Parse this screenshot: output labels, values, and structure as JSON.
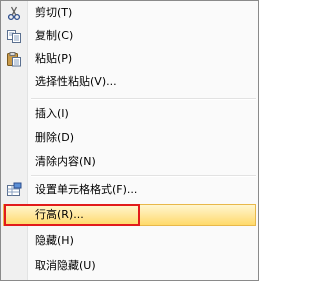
{
  "menu": {
    "items": [
      {
        "label": "剪切(T)",
        "icon": "scissors-icon"
      },
      {
        "label": "复制(C)",
        "icon": "copy-icon"
      },
      {
        "label": "粘贴(P)",
        "icon": "paste-icon"
      },
      {
        "label": "选择性粘贴(V)..."
      },
      {
        "label": "插入(I)"
      },
      {
        "label": "删除(D)"
      },
      {
        "label": "清除内容(N)"
      },
      {
        "label": "设置单元格格式(F)...",
        "icon": "format-cells-icon"
      },
      {
        "label": "行高(R)...",
        "highlighted": true
      },
      {
        "label": "隐藏(H)"
      },
      {
        "label": "取消隐藏(U)"
      }
    ]
  },
  "colors": {
    "highlight_border": "#e8b84a",
    "annotation_box": "#e21b1b"
  }
}
